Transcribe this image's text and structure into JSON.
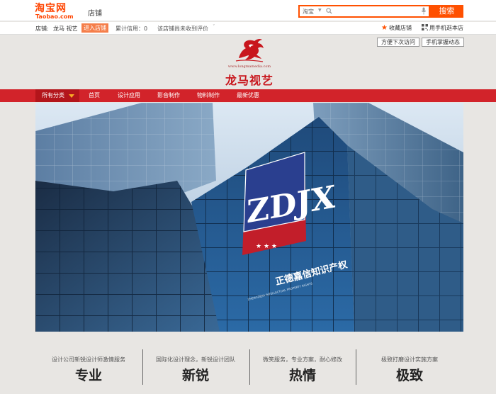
{
  "header": {
    "logo_cn": "淘宝网",
    "logo_en": "Taobao.com",
    "shop_tab": "店铺",
    "search": {
      "scope": "淘宝",
      "placeholder": "",
      "button": "搜索"
    }
  },
  "shop_info": {
    "label": "店铺:",
    "name": "龙马 视艺",
    "enter_button": "进入店铺",
    "credit": "累计信用：0",
    "reviews": "该店铺尚未收到评价",
    "favorite": "收藏店铺",
    "mobile": "用手机逛本店",
    "dropdown_visit": "方便下次访问",
    "dropdown_mobile": "手机掌握动态"
  },
  "brand": {
    "url": "www.longmamedia.com",
    "name": "龙马视艺"
  },
  "nav": {
    "all": "所有分类",
    "items": [
      "首页",
      "设计应用",
      "影音制作",
      "物料制作",
      "最新优惠"
    ]
  },
  "hero": {
    "sign_letters": "ZDJX",
    "sign_cn": "正德嘉信知识产权",
    "sign_en": "ZHENGDEJIA INTELLECTUAL PROPERTY RIGHTS"
  },
  "features": [
    {
      "desc": "设计公司新锐设计师激情服务",
      "title": "专业"
    },
    {
      "desc": "国际化设计理念，新锐设计团队",
      "title": "新锐"
    },
    {
      "desc": "微笑服务，专业方案，耐心修改",
      "title": "热情"
    },
    {
      "desc": "极致打磨设计实施方案",
      "title": "极致"
    }
  ],
  "colors": {
    "taobao_orange": "#ff5000",
    "nav_red": "#d2232a",
    "brand_red": "#c8161d"
  }
}
